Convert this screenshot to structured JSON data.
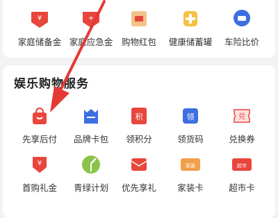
{
  "top_row": [
    {
      "label": "家庭储备金",
      "icon": "family-savings-icon"
    },
    {
      "label": "家庭应急金",
      "icon": "emergency-fund-icon"
    },
    {
      "label": "购物红包",
      "icon": "shopping-red-packet-icon"
    },
    {
      "label": "健康储蓄罐",
      "icon": "health-savings-jar-icon"
    },
    {
      "label": "车险比价",
      "icon": "car-insurance-icon"
    }
  ],
  "section": {
    "title": "娱乐购物服务",
    "row1": [
      {
        "label": "先享后付",
        "icon": "shopping-bag-icon"
      },
      {
        "label": "品牌卡包",
        "icon": "brand-card-wallet-icon"
      },
      {
        "label": "领积分",
        "icon": "points-icon",
        "glyph": "积"
      },
      {
        "label": "领货码",
        "icon": "coupon-code-icon",
        "glyph": "领"
      },
      {
        "label": "兑换券",
        "icon": "exchange-voucher-icon",
        "glyph": "兑"
      }
    ],
    "row2": [
      {
        "label": "首购礼金",
        "icon": "first-purchase-gift-icon"
      },
      {
        "label": "青绿计划",
        "icon": "green-plan-leaf-icon"
      },
      {
        "label": "优先享礼",
        "icon": "priority-gift-icon"
      },
      {
        "label": "家装卡",
        "icon": "home-decor-card-icon",
        "glyph": "家装"
      },
      {
        "label": "超市卡",
        "icon": "supermarket-card-icon",
        "glyph": "超市"
      }
    ]
  },
  "colors": {
    "accent_red": "#e8453c",
    "arrow_red": "#e53935"
  }
}
